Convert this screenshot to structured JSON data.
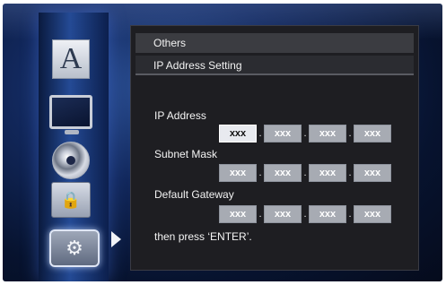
{
  "sidebar": {
    "items": [
      {
        "name": "language",
        "glyph": "A"
      },
      {
        "name": "display"
      },
      {
        "name": "disc-playback"
      },
      {
        "name": "parental-lock",
        "glyph": "🔒"
      },
      {
        "name": "others-settings",
        "glyph": "⚙",
        "selected": true
      }
    ]
  },
  "menu": {
    "breadcrumb_top": "Others",
    "breadcrumb_current": "IP Address Setting"
  },
  "fields": [
    {
      "label": "IP Address",
      "octets": [
        "xxx",
        "xxx",
        "xxx",
        "xxx"
      ],
      "selected_octet": 0
    },
    {
      "label": "Subnet Mask",
      "octets": [
        "xxx",
        "xxx",
        "xxx",
        "xxx"
      ]
    },
    {
      "label": "Default Gateway",
      "octets": [
        "xxx",
        "xxx",
        "xxx",
        "xxx"
      ]
    }
  ],
  "separator": ".",
  "hint": "then press ‘ENTER’.",
  "colors": {
    "panel_bg": "#1e1e22",
    "selected_octet": "#e8eaef",
    "octet": "#a7abb3",
    "sidebar_glow": "#244a95"
  }
}
